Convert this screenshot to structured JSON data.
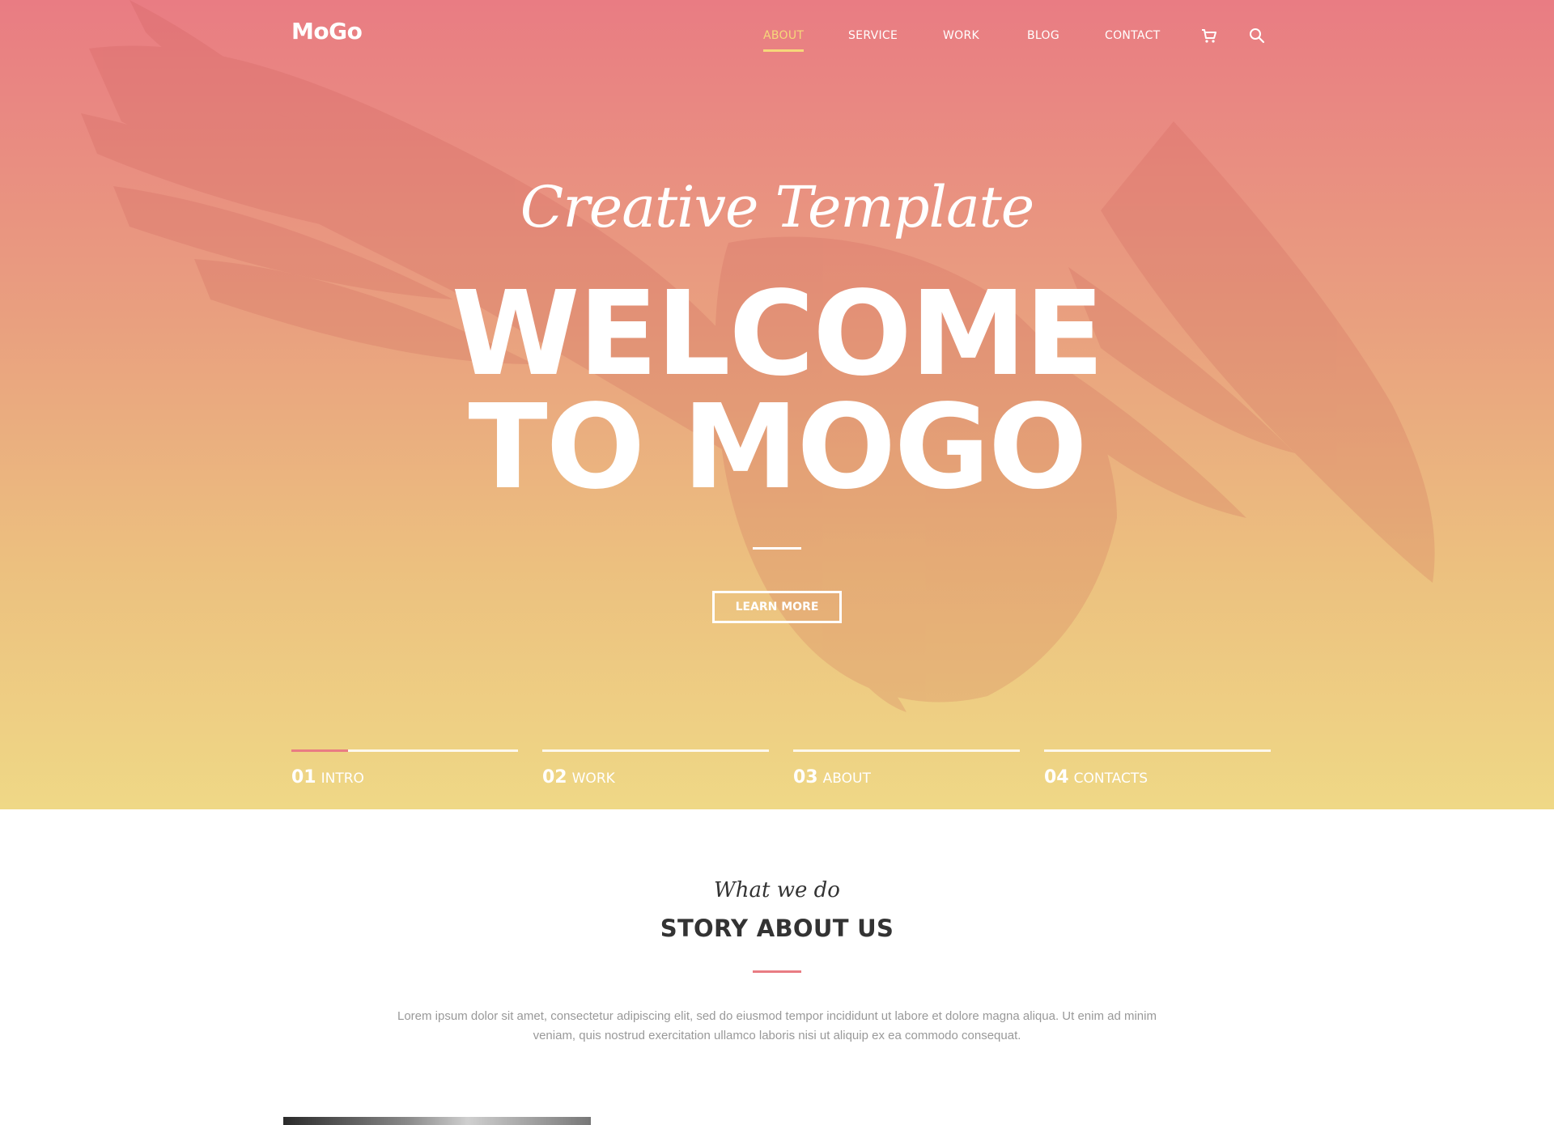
{
  "header": {
    "logo": "MoGo",
    "nav": [
      {
        "label": "ABOUT",
        "active": true
      },
      {
        "label": "SERVICE",
        "active": false
      },
      {
        "label": "WORK",
        "active": false
      },
      {
        "label": "BLOG",
        "active": false
      },
      {
        "label": "CONTACT",
        "active": false
      }
    ],
    "icons": [
      "cart-icon",
      "search-icon"
    ]
  },
  "hero": {
    "subtitle": "Creative Template",
    "headline_line1": "WELCOME",
    "headline_line2": "TO MOGO",
    "button_label": "LEARN MORE",
    "steps": [
      {
        "number": "01",
        "label": "INTRO",
        "progress": 0.25
      },
      {
        "number": "02",
        "label": "WORK",
        "progress": 0
      },
      {
        "number": "03",
        "label": "ABOUT",
        "progress": 0
      },
      {
        "number": "04",
        "label": "CONTACTS",
        "progress": 0
      }
    ]
  },
  "story": {
    "eyebrow": "What we do",
    "title": "STORY ABOUT US",
    "text": "Lorem ipsum dolor sit amet, consectetur adipiscing elit, sed do eiusmod tempor incididunt ut labore et dolore magna aliqua. Ut enim ad minim veniam, quis nostrud exercitation ullamco laboris nisi ut aliquip ex ea commodo consequat."
  },
  "colors": {
    "gradient_top": "#e97c83",
    "gradient_bottom": "#efd886",
    "accent_active": "#f6d87a",
    "accent_red": "#e97c83"
  }
}
